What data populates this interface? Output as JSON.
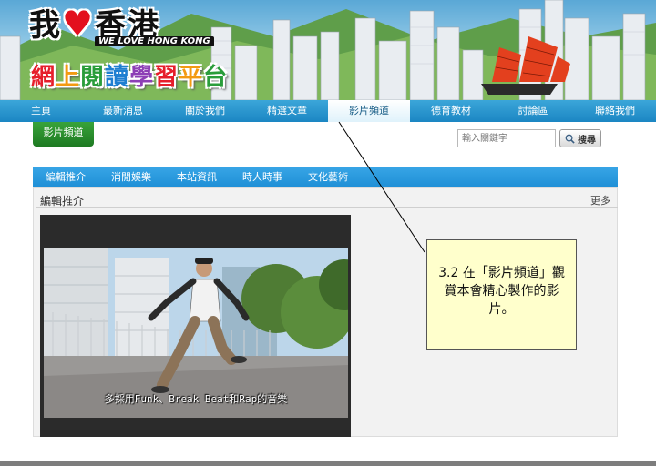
{
  "logo": {
    "title_chars": [
      "我",
      "香港"
    ],
    "heart": "♥",
    "tagline": "WE LOVE HONG KONG",
    "platform": [
      "網",
      "上",
      "閱",
      "讀",
      "學",
      "習",
      "平",
      "台"
    ]
  },
  "nav": {
    "items": [
      "主頁",
      "最新消息",
      "關於我們",
      "精選文章",
      "影片頻道",
      "德育教材",
      "討論區",
      "聯絡我們"
    ],
    "active_index": 4
  },
  "channel_tab": "影片頻道",
  "search": {
    "placeholder": "輸入關鍵字",
    "button_label": "搜尋"
  },
  "subtabs": [
    "編輯推介",
    "消閒娛樂",
    "本站資訊",
    "時人時事",
    "文化藝術"
  ],
  "section": {
    "title": "編輯推介",
    "more": "更多"
  },
  "video": {
    "caption": "多採用Funk、Break Beat和Rap的音樂"
  },
  "note": {
    "number": "3.2",
    "text": " 在「影片頻道」觀賞本會精心製作的影片。"
  },
  "colors": {
    "nav_blue": "#1b86c3",
    "channel_green": "#1e7a22",
    "subtab_blue": "#1e8fd6",
    "note_bg": "#ffffcc",
    "heart_red": "#e3101e"
  }
}
